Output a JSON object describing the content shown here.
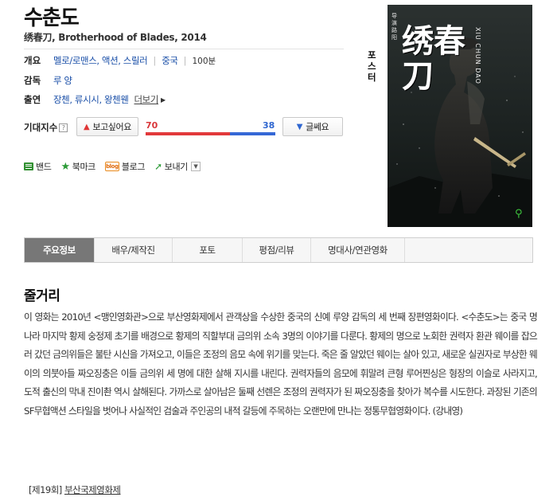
{
  "movie": {
    "title": "수춘도",
    "subtitle": "绣春刀, Brotherhood of Blades, 2014"
  },
  "info": {
    "overview_label": "개요",
    "genres": [
      "멜로/로맨스",
      "액션",
      "스릴러"
    ],
    "country": "중국",
    "runtime": "100분",
    "director_label": "감독",
    "director": "루 양",
    "cast_label": "출연",
    "cast": [
      "장첸",
      "류시시",
      "왕첸웬"
    ],
    "more_label": "더보기"
  },
  "expectation": {
    "label": "기대지수",
    "help": "?",
    "want_button": "보고싶어요",
    "skip_button": "글쎄요",
    "want_count": 70,
    "skip_count": 38
  },
  "share": {
    "band": "밴드",
    "bookmark": "북마크",
    "blog": "블로그",
    "blog_icon_text": "blog",
    "send": "보내기"
  },
  "poster": {
    "side_label": "포스터",
    "title_chars": "绣春刀",
    "en_title": "XIU CHUN DAO",
    "small_text": "导演 路阳"
  },
  "tabs": [
    "주요정보",
    "배우/제작진",
    "포토",
    "평점/리뷰",
    "명대사/연관영화"
  ],
  "synopsis": {
    "heading": "줄거리",
    "text": "이 영화는 2010년 <맹인영화관>으로 부산영화제에서 관객상을 수상한 중국의 신예 루양 감독의 세 번째 장편영화이다. <수춘도>는 중국 명나라 마지막 황제 숭정제 초기를 배경으로 황제의 직할부대 금의위 소속 3명의 이야기를 다룬다. 황제의 명으로 노회한 권력자 환관 웨이를 잡으러 갔던 금의위들은 불탄 시신을 가져오고, 이들은 조정의 음모 속에 위기를 맞는다. 죽은 줄 알았던 웨이는 살아 있고, 새로운 실권자로 부상한 웨이의 의붓아들 짜오징충은 이들 금의위 세 명에 대한 살해 지시를 내린다. 권력자들의 음모에 휘말려 큰형 루어찐싱은 형장의 이슬로 사라지고, 도적 출신의 막내 진이촨 역시 살해된다. 가까스로 살아남은 둘째 선렌은 조정의 권력자가 된 짜오징충을 찾아가 복수를 시도한다. 과장된 기존의 SF무협액션 스타일을 벗어나 사실적인 검술과 주인공의 내적 갈등에 주목하는 오랜만에 만나는 정통무협영화이다. (강내영)"
  },
  "festival": {
    "bracket": "[제19회]",
    "name": "부산국제영화제"
  }
}
